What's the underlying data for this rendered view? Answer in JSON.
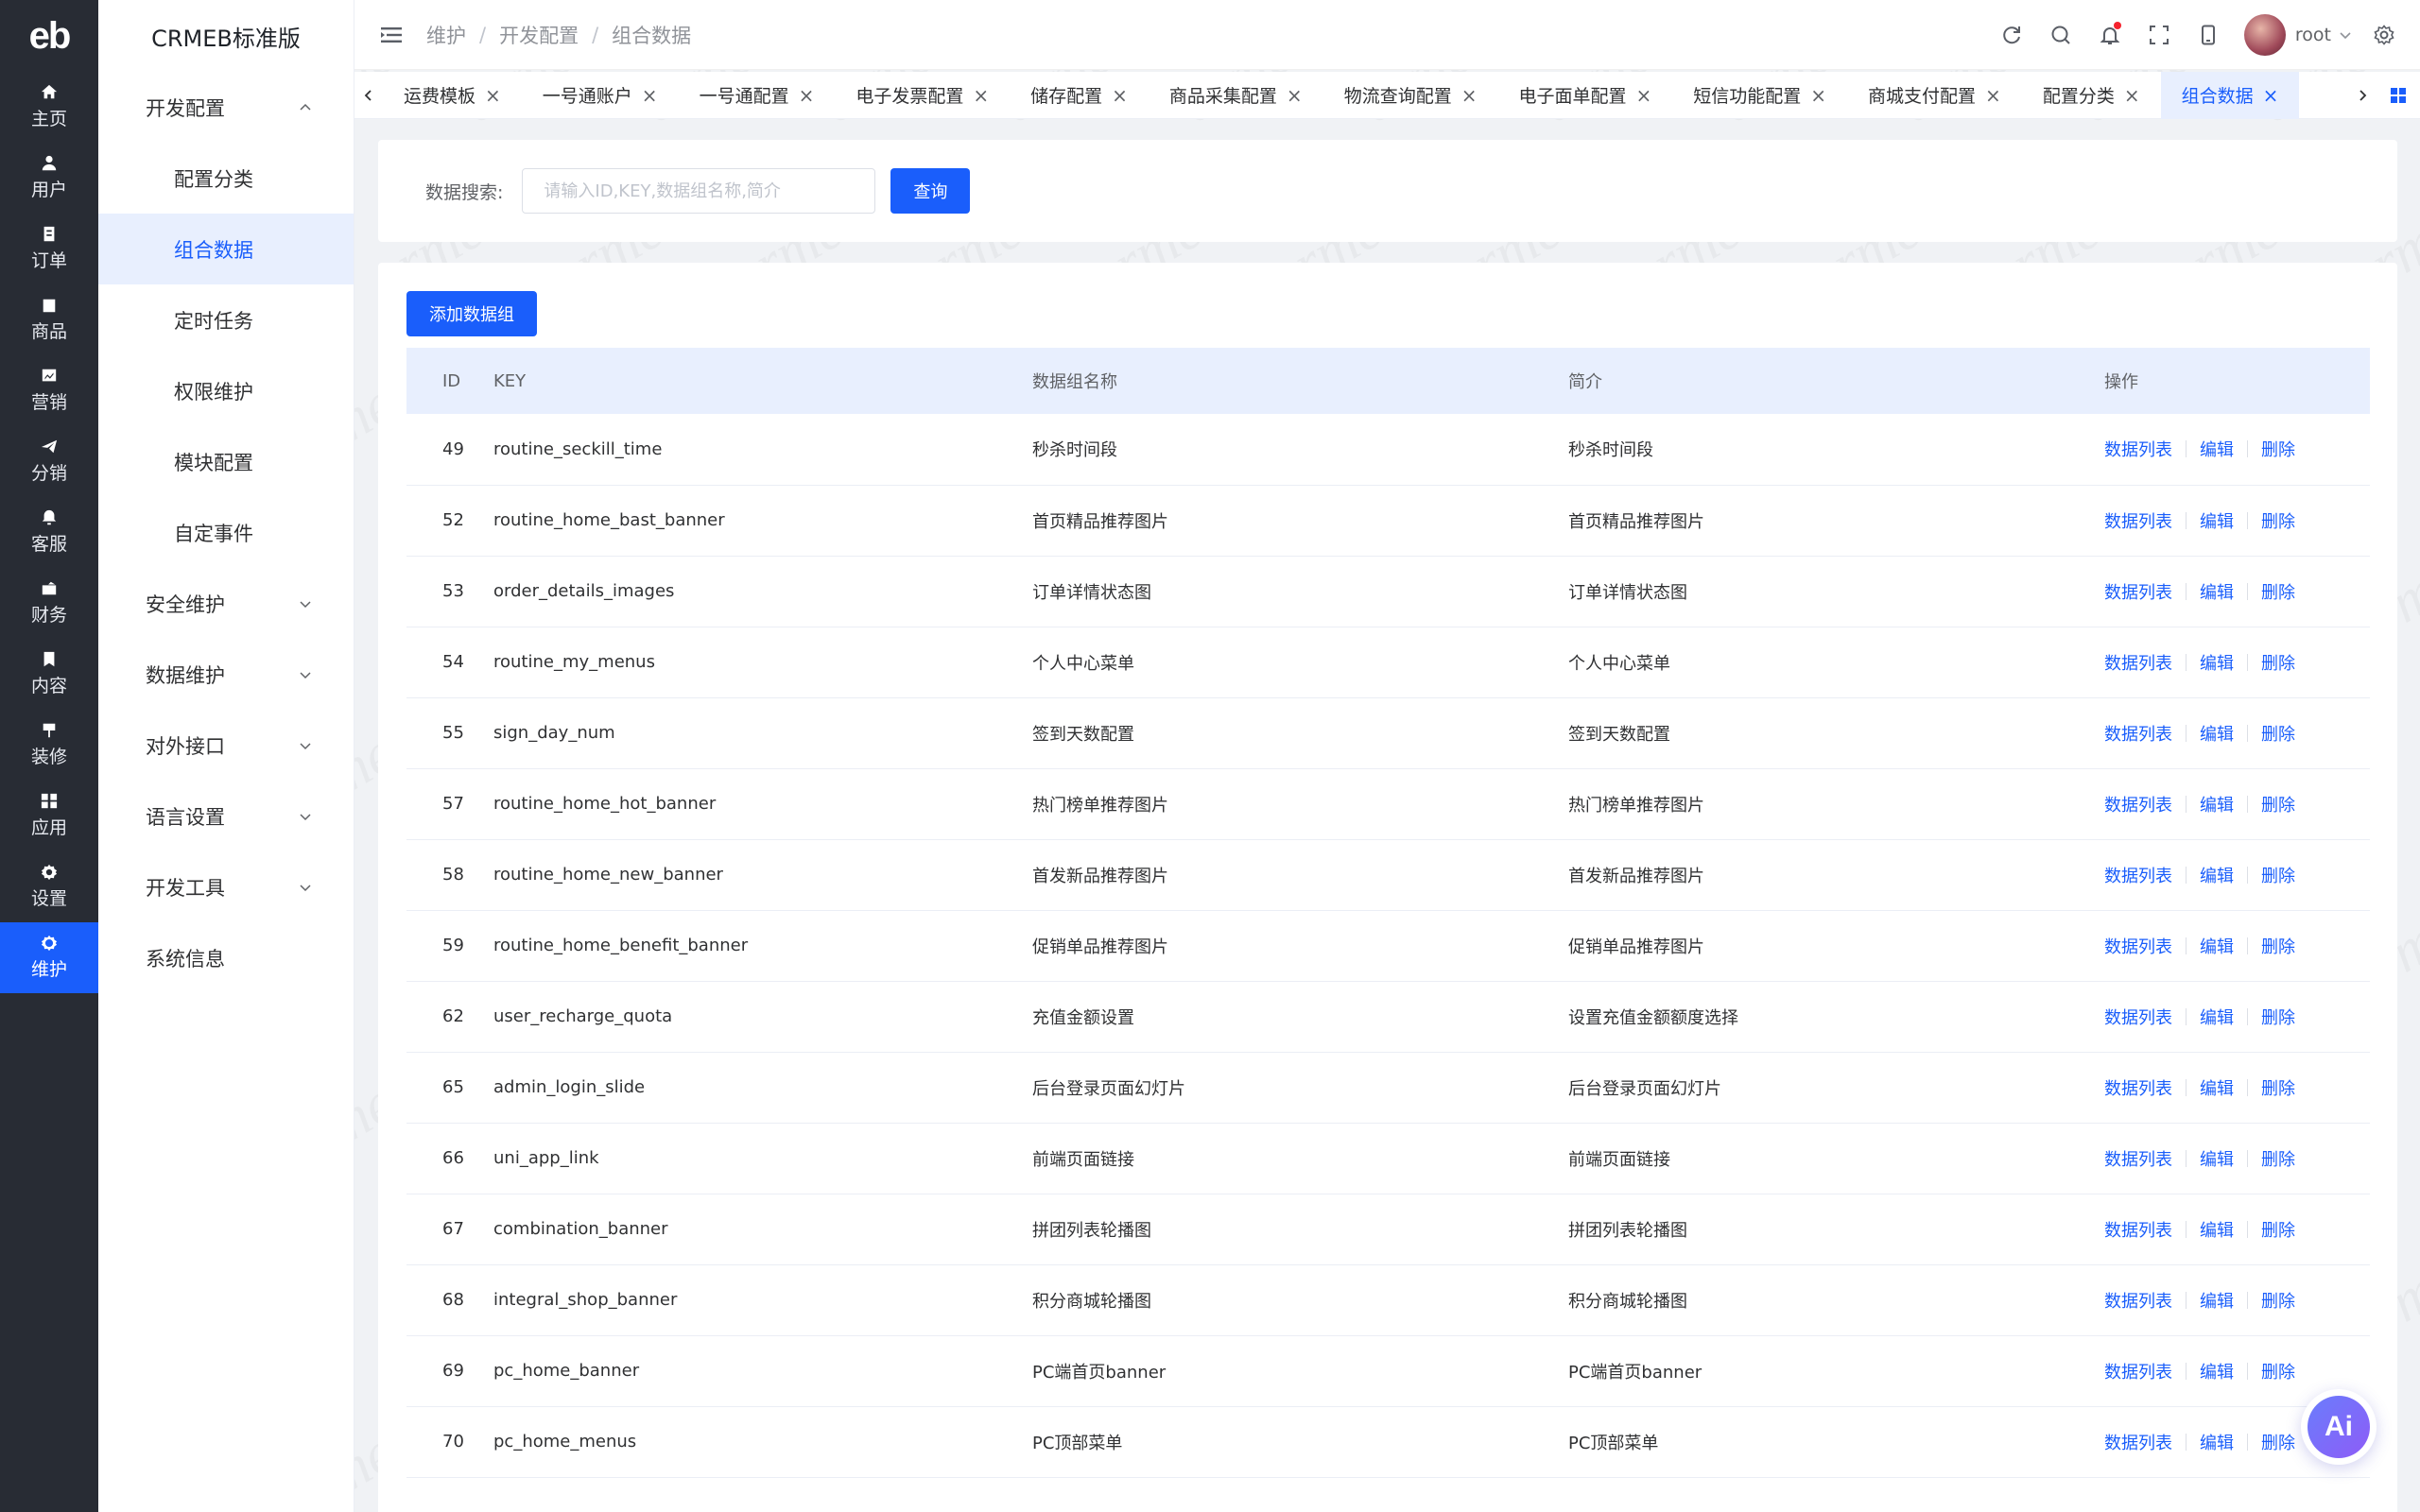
{
  "logo": "eb",
  "rail": [
    {
      "label": "主页",
      "icon": "home-icon"
    },
    {
      "label": "用户",
      "icon": "user-icon"
    },
    {
      "label": "订单",
      "icon": "order-icon"
    },
    {
      "label": "商品",
      "icon": "product-icon"
    },
    {
      "label": "营销",
      "icon": "marketing-icon"
    },
    {
      "label": "分销",
      "icon": "distribution-icon"
    },
    {
      "label": "客服",
      "icon": "service-icon"
    },
    {
      "label": "财务",
      "icon": "finance-icon"
    },
    {
      "label": "内容",
      "icon": "content-icon"
    },
    {
      "label": "装修",
      "icon": "decorate-icon"
    },
    {
      "label": "应用",
      "icon": "apps-icon"
    },
    {
      "label": "设置",
      "icon": "settings-icon"
    },
    {
      "label": "维护",
      "icon": "maintain-icon",
      "active": true
    }
  ],
  "subnav": {
    "title": "CRMEB标准版",
    "items": [
      {
        "label": "开发配置",
        "type": "group",
        "expanded": true
      },
      {
        "label": "配置分类",
        "type": "item"
      },
      {
        "label": "组合数据",
        "type": "item",
        "active": true
      },
      {
        "label": "定时任务",
        "type": "item"
      },
      {
        "label": "权限维护",
        "type": "item"
      },
      {
        "label": "模块配置",
        "type": "item"
      },
      {
        "label": "自定事件",
        "type": "item"
      },
      {
        "label": "安全维护",
        "type": "group"
      },
      {
        "label": "数据维护",
        "type": "group"
      },
      {
        "label": "对外接口",
        "type": "group"
      },
      {
        "label": "语言设置",
        "type": "group"
      },
      {
        "label": "开发工具",
        "type": "group"
      },
      {
        "label": "系统信息",
        "type": "plain"
      }
    ]
  },
  "header": {
    "breadcrumb": [
      "维护",
      "开发配置",
      "组合数据"
    ],
    "user": "root"
  },
  "tabs": [
    {
      "label": "运费模板"
    },
    {
      "label": "一号通账户"
    },
    {
      "label": "一号通配置"
    },
    {
      "label": "电子发票配置"
    },
    {
      "label": "储存配置"
    },
    {
      "label": "商品采集配置"
    },
    {
      "label": "物流查询配置"
    },
    {
      "label": "电子面单配置"
    },
    {
      "label": "短信功能配置"
    },
    {
      "label": "商城支付配置"
    },
    {
      "label": "配置分类"
    },
    {
      "label": "组合数据",
      "active": true
    }
  ],
  "search": {
    "label": "数据搜索:",
    "placeholder": "请输入ID,KEY,数据组名称,简介",
    "value": "",
    "button": "查询"
  },
  "table": {
    "add_button": "添加数据组",
    "columns": [
      "ID",
      "KEY",
      "数据组名称",
      "简介",
      "操作"
    ],
    "actions": [
      "数据列表",
      "编辑",
      "删除"
    ],
    "rows": [
      {
        "id": "49",
        "key": "routine_seckill_time",
        "name": "秒杀时间段",
        "desc": "秒杀时间段"
      },
      {
        "id": "52",
        "key": "routine_home_bast_banner",
        "name": "首页精品推荐图片",
        "desc": "首页精品推荐图片"
      },
      {
        "id": "53",
        "key": "order_details_images",
        "name": "订单详情状态图",
        "desc": "订单详情状态图"
      },
      {
        "id": "54",
        "key": "routine_my_menus",
        "name": "个人中心菜单",
        "desc": "个人中心菜单"
      },
      {
        "id": "55",
        "key": "sign_day_num",
        "name": "签到天数配置",
        "desc": "签到天数配置"
      },
      {
        "id": "57",
        "key": "routine_home_hot_banner",
        "name": "热门榜单推荐图片",
        "desc": "热门榜单推荐图片"
      },
      {
        "id": "58",
        "key": "routine_home_new_banner",
        "name": "首发新品推荐图片",
        "desc": "首发新品推荐图片"
      },
      {
        "id": "59",
        "key": "routine_home_benefit_banner",
        "name": "促销单品推荐图片",
        "desc": "促销单品推荐图片"
      },
      {
        "id": "62",
        "key": "user_recharge_quota",
        "name": "充值金额设置",
        "desc": "设置充值金额额度选择"
      },
      {
        "id": "65",
        "key": "admin_login_slide",
        "name": "后台登录页面幻灯片",
        "desc": "后台登录页面幻灯片"
      },
      {
        "id": "66",
        "key": "uni_app_link",
        "name": "前端页面链接",
        "desc": "前端页面链接"
      },
      {
        "id": "67",
        "key": "combination_banner",
        "name": "拼团列表轮播图",
        "desc": "拼团列表轮播图"
      },
      {
        "id": "68",
        "key": "integral_shop_banner",
        "name": "积分商城轮播图",
        "desc": "积分商城轮播图"
      },
      {
        "id": "69",
        "key": "pc_home_banner",
        "name": "PC端首页banner",
        "desc": "PC端首页banner"
      },
      {
        "id": "70",
        "key": "pc_home_menus",
        "name": "PC顶部菜单",
        "desc": "PC顶部菜单"
      }
    ]
  },
  "ai_button": "Ai",
  "watermark": "crmeb",
  "colors": {
    "accent": "#1a5efb",
    "rail_bg": "#282c34",
    "header_row_bg": "#e8effe"
  }
}
